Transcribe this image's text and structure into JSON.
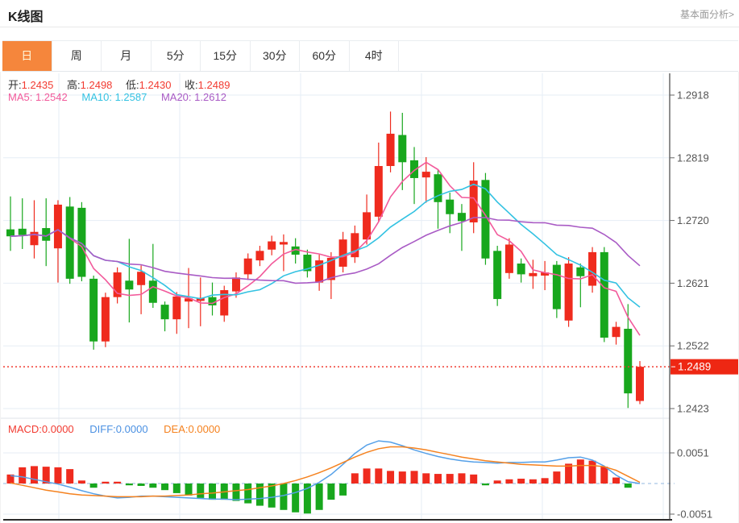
{
  "page": {
    "title": "K线图",
    "analysis_link": "基本面分析>"
  },
  "tabs": [
    {
      "label": "日",
      "active": true
    },
    {
      "label": "周",
      "active": false
    },
    {
      "label": "月",
      "active": false
    },
    {
      "label": "5分",
      "active": false
    },
    {
      "label": "15分",
      "active": false
    },
    {
      "label": "30分",
      "active": false
    },
    {
      "label": "60分",
      "active": false
    },
    {
      "label": "4时",
      "active": false
    }
  ],
  "quote": {
    "open_label": "开:",
    "open": "1.2435",
    "high_label": "高:",
    "high": "1.2498",
    "low_label": "低:",
    "low": "1.2430",
    "close_label": "收:",
    "close": "1.2489"
  },
  "ma": {
    "ma5_label": "MA5:",
    "ma5": "1.2542",
    "ma10_label": "MA10:",
    "ma10": "1.2587",
    "ma20_label": "MA20:",
    "ma20": "1.2612"
  },
  "macd_header": {
    "macd_label": "MACD:",
    "macd": "0.0000",
    "diff_label": "DIFF:",
    "diff": "0.0000",
    "dea_label": "DEA:",
    "dea": "0.0000"
  },
  "price_badge": "1.2489",
  "colors": {
    "up": "#ef2b1e",
    "down": "#18a71d",
    "ma5": "#f25a9b",
    "ma10": "#33c2e2",
    "ma20": "#a95bc5",
    "diff_line": "#55a0e8",
    "dea_line": "#f5821f",
    "tab_active_bg": "#f5863c",
    "badge_bg": "#ee2713",
    "value_red": "#f23b31",
    "grid": "#e6edf5",
    "zero_dash": "#a9c7e6",
    "axis_line": "#444444",
    "price_dotted": "#f03c30",
    "axis_text": "#555555"
  },
  "chart_data": [
    {
      "type": "candlestick",
      "title": "K线图 (daily K-line with MA5/MA10/MA20)",
      "y_ticks": [
        "1.2918",
        "1.2819",
        "1.2720",
        "1.2621",
        "1.2522",
        "1.2423"
      ],
      "y_max": 1.2918,
      "y_min": 1.2423,
      "last_price": 1.2489,
      "ma_periods": [
        5,
        10,
        20
      ],
      "candles_format": [
        "open",
        "high",
        "low",
        "close"
      ],
      "candles": [
        [
          1.2706,
          1.2758,
          1.2672,
          1.2695
        ],
        [
          1.2707,
          1.2755,
          1.2675,
          1.2697
        ],
        [
          1.2681,
          1.2752,
          1.266,
          1.2702
        ],
        [
          1.2708,
          1.2755,
          1.2648,
          1.2688
        ],
        [
          1.2676,
          1.2752,
          1.2622,
          1.2745
        ],
        [
          1.2742,
          1.2757,
          1.262,
          1.2628
        ],
        [
          1.274,
          1.2749,
          1.2624,
          1.2631
        ],
        [
          1.2628,
          1.2633,
          1.2516,
          1.2529
        ],
        [
          1.2529,
          1.2606,
          1.252,
          1.2599
        ],
        [
          1.2599,
          1.2646,
          1.2589,
          1.2638
        ],
        [
          1.2625,
          1.2691,
          1.2559,
          1.2611
        ],
        [
          1.2618,
          1.2649,
          1.2572,
          1.2639
        ],
        [
          1.2625,
          1.2683,
          1.2582,
          1.259
        ],
        [
          1.2587,
          1.2592,
          1.2545,
          1.2564
        ],
        [
          1.2564,
          1.2607,
          1.2541,
          1.26
        ],
        [
          1.2592,
          1.2645,
          1.255,
          1.2597
        ],
        [
          1.2593,
          1.263,
          1.2553,
          1.2598
        ],
        [
          1.2599,
          1.2622,
          1.257,
          1.2586
        ],
        [
          1.257,
          1.2617,
          1.256,
          1.261
        ],
        [
          1.2608,
          1.2638,
          1.2598,
          1.263
        ],
        [
          1.2635,
          1.2668,
          1.2626,
          1.266
        ],
        [
          1.2657,
          1.268,
          1.2648,
          1.2672
        ],
        [
          1.2674,
          1.2696,
          1.2665,
          1.2687
        ],
        [
          1.2682,
          1.2698,
          1.264,
          1.2686
        ],
        [
          1.2679,
          1.2692,
          1.2652,
          1.2666
        ],
        [
          1.2666,
          1.2674,
          1.263,
          1.264
        ],
        [
          1.2622,
          1.2666,
          1.2609,
          1.2657
        ],
        [
          1.2626,
          1.267,
          1.2596,
          1.2661
        ],
        [
          1.2647,
          1.2702,
          1.2638,
          1.269
        ],
        [
          1.2662,
          1.2712,
          1.2653,
          1.27
        ],
        [
          1.269,
          1.2761,
          1.2682,
          1.2733
        ],
        [
          1.2726,
          1.2843,
          1.2718,
          1.2806
        ],
        [
          1.2806,
          1.2892,
          1.2796,
          1.2857
        ],
        [
          1.2855,
          1.289,
          1.2768,
          1.2812
        ],
        [
          1.2815,
          1.2836,
          1.2746,
          1.2787
        ],
        [
          1.2788,
          1.282,
          1.2748,
          1.2797
        ],
        [
          1.2793,
          1.28,
          1.2707,
          1.2749
        ],
        [
          1.2753,
          1.2764,
          1.27,
          1.273
        ],
        [
          1.2732,
          1.2746,
          1.2672,
          1.2719
        ],
        [
          1.2717,
          1.2812,
          1.27,
          1.2783
        ],
        [
          1.2784,
          1.2795,
          1.265,
          1.266
        ],
        [
          1.2672,
          1.268,
          1.2585,
          1.2596
        ],
        [
          1.2637,
          1.2692,
          1.2628,
          1.2682
        ],
        [
          1.2652,
          1.266,
          1.2622,
          1.2635
        ],
        [
          1.2632,
          1.2658,
          1.2612,
          1.2637
        ],
        [
          1.2633,
          1.2656,
          1.261,
          1.2638
        ],
        [
          1.265,
          1.2656,
          1.2566,
          1.258
        ],
        [
          1.2562,
          1.2662,
          1.2552,
          1.2652
        ],
        [
          1.2646,
          1.2652,
          1.2583,
          1.2632
        ],
        [
          1.2617,
          1.2678,
          1.2606,
          1.267
        ],
        [
          1.267,
          1.2678,
          1.2528,
          1.2535
        ],
        [
          1.2536,
          1.256,
          1.2524,
          1.2552
        ],
        [
          1.2549,
          1.2588,
          1.2424,
          1.2447
        ],
        [
          1.2435,
          1.2498,
          1.243,
          1.2489
        ]
      ]
    },
    {
      "type": "bar",
      "name": "MACD",
      "y_ticks": [
        "0.0051",
        "-0.0051"
      ],
      "y_max": 0.0051,
      "y_min": -0.0051,
      "histogram": [
        0.0015,
        0.0027,
        0.0029,
        0.0028,
        0.0027,
        0.0024,
        0.0005,
        -0.0007,
        0.0003,
        0.0003,
        -0.0003,
        -0.0004,
        -0.0007,
        -0.0011,
        -0.0016,
        -0.002,
        -0.0024,
        -0.0027,
        -0.0027,
        -0.0029,
        -0.0033,
        -0.0037,
        -0.004,
        -0.0044,
        -0.0048,
        -0.005,
        -0.0044,
        -0.0027,
        -0.002,
        0.0017,
        0.0025,
        0.0025,
        0.0021,
        0.002,
        0.0021,
        0.0017,
        0.0016,
        0.0016,
        0.0017,
        0.0015,
        -0.0003,
        0.0005,
        0.0007,
        0.0008,
        0.0007,
        0.0009,
        0.002,
        0.0033,
        0.004,
        0.0038,
        0.0028,
        0.001,
        -0.0007,
        0.0
      ],
      "series": [
        {
          "name": "DIFF",
          "values": [
            0.0013,
            0.0011,
            0.0007,
            0.0003,
            -0.0001,
            -0.0006,
            -0.0012,
            -0.0017,
            -0.0021,
            -0.0024,
            -0.0023,
            -0.0021,
            -0.0021,
            -0.0022,
            -0.0023,
            -0.0024,
            -0.0025,
            -0.0026,
            -0.0026,
            -0.0027,
            -0.0026,
            -0.0025,
            -0.0023,
            -0.002,
            -0.0015,
            -0.0008,
            0.0002,
            0.0015,
            0.0032,
            0.005,
            0.0064,
            0.0071,
            0.0069,
            0.0063,
            0.0056,
            0.005,
            0.0045,
            0.0041,
            0.0038,
            0.0036,
            0.0035,
            0.0034,
            0.0035,
            0.0035,
            0.0036,
            0.0036,
            0.0039,
            0.0043,
            0.0044,
            0.0039,
            0.0029,
            0.0014,
            0.0003,
            0.0
          ]
        },
        {
          "name": "DEA",
          "values": [
            0.0001,
            -0.0003,
            -0.0007,
            -0.0011,
            -0.0014,
            -0.0017,
            -0.0019,
            -0.002,
            -0.0021,
            -0.0022,
            -0.0022,
            -0.0022,
            -0.0021,
            -0.0021,
            -0.002,
            -0.0019,
            -0.0017,
            -0.0016,
            -0.0014,
            -0.0012,
            -0.001,
            -0.0007,
            -0.0004,
            0.0,
            0.0005,
            0.0011,
            0.0018,
            0.0026,
            0.0035,
            0.0044,
            0.0052,
            0.0058,
            0.0061,
            0.0061,
            0.0059,
            0.0056,
            0.0052,
            0.0048,
            0.0044,
            0.0041,
            0.0038,
            0.0036,
            0.0034,
            0.0032,
            0.0031,
            0.003,
            0.0029,
            0.0029,
            0.003,
            0.003,
            0.0028,
            0.0022,
            0.0012,
            0.0002
          ]
        }
      ]
    }
  ]
}
